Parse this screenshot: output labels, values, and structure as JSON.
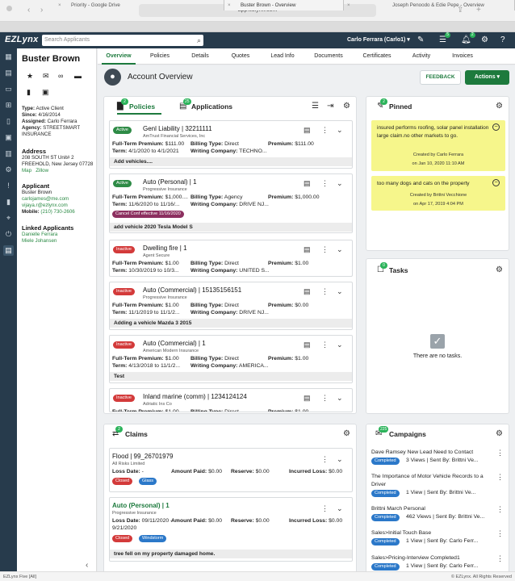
{
  "browser": {
    "url": "app.ezlynx.com",
    "tabs": [
      {
        "label": "Priority - Google Drive"
      },
      {
        "label": "Buster Brown - Overview"
      },
      {
        "label": "Joseph Penoodo & Edie Pepe - Overview"
      }
    ]
  },
  "appbar": {
    "logo": "EZLynx",
    "search_placeholder": "Search Applicants",
    "user": "Carlo Ferrara (Carlo1) ▾",
    "badges": {
      "list": "5",
      "notifications": "2"
    }
  },
  "sidebar": {
    "client_name": "Buster Brown",
    "type_label": "Type:",
    "type_value": "Active Client",
    "since_label": "Since:",
    "since_value": "4/16/2014",
    "assigned_label": "Assigned:",
    "assigned_value": "Carlo Ferrara",
    "agency_label": "Agency:",
    "agency_value": "STREETSMART INSURANCE",
    "address_head": "Address",
    "address_line1": "208 SOUTH ST Unit# 2",
    "address_line2": "FREEHOLD, New Jersey 07728",
    "map_link": "Map",
    "zillow_link": "Zillow",
    "applicant_head": "Applicant",
    "applicant_name": "Buster Brown",
    "email1": "carlojames@me.com",
    "email2": "vijaya.r@ezlynx.com",
    "mobile_label": "Mobile:",
    "mobile_value": "(210) 730-2606",
    "linked_head": "Linked Applicants",
    "linked": [
      "Danielle Ferrara",
      "Miele Johansen"
    ]
  },
  "tabs": [
    "Overview",
    "Policies",
    "Details",
    "Quotes",
    "Lead Info",
    "Documents",
    "Certificates",
    "Activity",
    "Invoices"
  ],
  "overview": {
    "title": "Account Overview",
    "feedback": "FEEDBACK",
    "actions": "Actions ▾"
  },
  "policies_panel": {
    "tab_policies": "Policies",
    "tab_policies_count": "2",
    "tab_applications": "Applications",
    "tab_applications_count": "25",
    "cards": [
      {
        "status": "Active",
        "title": "Genl Liability | 32211111",
        "carrier": "AmTrust Financial Services, Inc",
        "premium_label": "Full-Term Premium:",
        "premium": "$111.00",
        "billing_label": "Billing Type:",
        "billing": "Direct",
        "premium2_label": "Premium:",
        "premium2": "$111.00",
        "term_label": "Term:",
        "term": "4/1/2020 to 4/1/2021",
        "wc_label": "Writing Company:",
        "wc": "TECHNO...",
        "note": "Add vehicles....",
        "extra": ""
      },
      {
        "status": "Active",
        "title": "Auto (Personal) | 1",
        "carrier": "Progressive Insurance",
        "premium_label": "Full-Term Premium:",
        "premium": "$1,000....",
        "billing_label": "Billing Type:",
        "billing": "Agency",
        "premium2_label": "Premium:",
        "premium2": "$1,000.00",
        "term_label": "Term:",
        "term": "11/6/2020 to 11/16/...",
        "wc_label": "Writing Company:",
        "wc": "DRIVE NJ...",
        "note": "add vehicle 2020 Tesla Model S",
        "extra": "Cancel Conf effective 11/16/2020"
      },
      {
        "status": "Inactive",
        "title": "Dwelling fire | 1",
        "carrier": "Agent Secure",
        "premium_label": "Full-Term Premium:",
        "premium": "$1.00",
        "billing_label": "Billing Type:",
        "billing": "Direct",
        "premium2_label": "Premium:",
        "premium2": "$1.00",
        "term_label": "Term:",
        "term": "10/30/2019 to 10/3...",
        "wc_label": "Writing Company:",
        "wc": "UNITED S...",
        "note": "",
        "extra": ""
      },
      {
        "status": "Inactive",
        "title": "Auto (Commercial) | 15135156151",
        "carrier": "Progressive Insurance",
        "premium_label": "Full-Term Premium:",
        "premium": "$1.00",
        "billing_label": "Billing Type:",
        "billing": "Direct",
        "premium2_label": "Premium:",
        "premium2": "$0.00",
        "term_label": "Term:",
        "term": "11/1/2019 to 11/1/2...",
        "wc_label": "Writing Company:",
        "wc": "DRIVE NJ...",
        "note": "Adding a vehicle Mazda 3 2015",
        "extra": ""
      },
      {
        "status": "Inactive",
        "title": "Auto (Commercial) | 1",
        "carrier": "American Modern Insurance",
        "premium_label": "Full-Term Premium:",
        "premium": "$1.00",
        "billing_label": "Billing Type:",
        "billing": "Direct",
        "premium2_label": "Premium:",
        "premium2": "$1.00",
        "term_label": "Term:",
        "term": "4/13/2018 to 11/1/2...",
        "wc_label": "Writing Company:",
        "wc": "AMERICA...",
        "note": "Test",
        "extra": ""
      },
      {
        "status": "Inactive",
        "title": "Inland marine (comm) | 1234124124",
        "carrier": "Adriatic Ins Co",
        "premium_label": "Full-Term Premium:",
        "premium": "$1.00",
        "billing_label": "Billing Type:",
        "billing": "Direct",
        "premium2_label": "Premium:",
        "premium2": "$1.00",
        "term_label": "",
        "term": "",
        "wc_label": "",
        "wc": "",
        "note": "",
        "extra": ""
      }
    ]
  },
  "pinned": {
    "title": "Pinned",
    "count": "2",
    "notes": [
      {
        "text": "insured performs roofing, solar panel installation large claim.no other markets to go.",
        "by": "Created by Carlo Ferrara",
        "on": "on Jan 10, 2020 11:10 AM"
      },
      {
        "text": "too many dogs and cats on the property",
        "by": "Created by Brittni Vecchione",
        "on": "on Apr 17, 2019 4:04 PM"
      }
    ]
  },
  "tasks": {
    "title": "Tasks",
    "count": "0",
    "empty": "There are no tasks."
  },
  "claims": {
    "title": "Claims",
    "count": "2",
    "items": [
      {
        "title": "Flood | 99_26701979",
        "carrier": "All Risks Limited",
        "loss_label": "Loss Date:",
        "loss": "-",
        "paid_label": "Amount Paid:",
        "paid": "$0.00",
        "reserve_label": "Reserve:",
        "reserve": "$0.00",
        "incurred_label": "Incurred Loss:",
        "incurred": "$0.00",
        "loss2": "",
        "tags": [
          "Closed",
          "Glass"
        ],
        "note": ""
      },
      {
        "title": "Auto (Personal) | 1",
        "carrier": "Progressive Insurance",
        "loss_label": "Loss Date:",
        "loss": "09/11/2020 -",
        "paid_label": "Amount Paid:",
        "paid": "$0.00",
        "reserve_label": "Reserve:",
        "reserve": "$0.00",
        "incurred_label": "Incurred Loss:",
        "incurred": "$0.00",
        "loss2": "9/21/2020",
        "tags": [
          "Closed",
          "Windstorm"
        ],
        "note": "tree fell on my property damaged home."
      }
    ]
  },
  "campaigns": {
    "title": "Campaigns",
    "count": "225",
    "items": [
      {
        "title": "Dave Ramsey New Lead Need to Contact",
        "status": "Completed",
        "meta": "3 Views | Sent By: Brittni Ve..."
      },
      {
        "title": "The Importance of Motor Vehicle Records to a Driver",
        "status": "Completed",
        "meta": "1 View | Sent By: Brittni Ve..."
      },
      {
        "title": "Brittni March Personal",
        "status": "Completed",
        "meta": "462 Views | Sent By: Brittni Ve..."
      },
      {
        "title": "Sales>Initial Touch Base",
        "status": "Completed",
        "meta": "1 View | Sent By: Carlo Ferr..."
      },
      {
        "title": "Sales>Pricing-Interview Completed1",
        "status": "Completed",
        "meta": "1 View | Sent By: Carlo Ferr..."
      }
    ]
  },
  "statusbar": {
    "left": "EZLynx Five [All]",
    "right": "© EZLynx. All Rights Reserved"
  },
  "colors": {
    "brand": "#273b4c",
    "accent": "#1d7a3d",
    "pinned": "#f6f68b"
  }
}
